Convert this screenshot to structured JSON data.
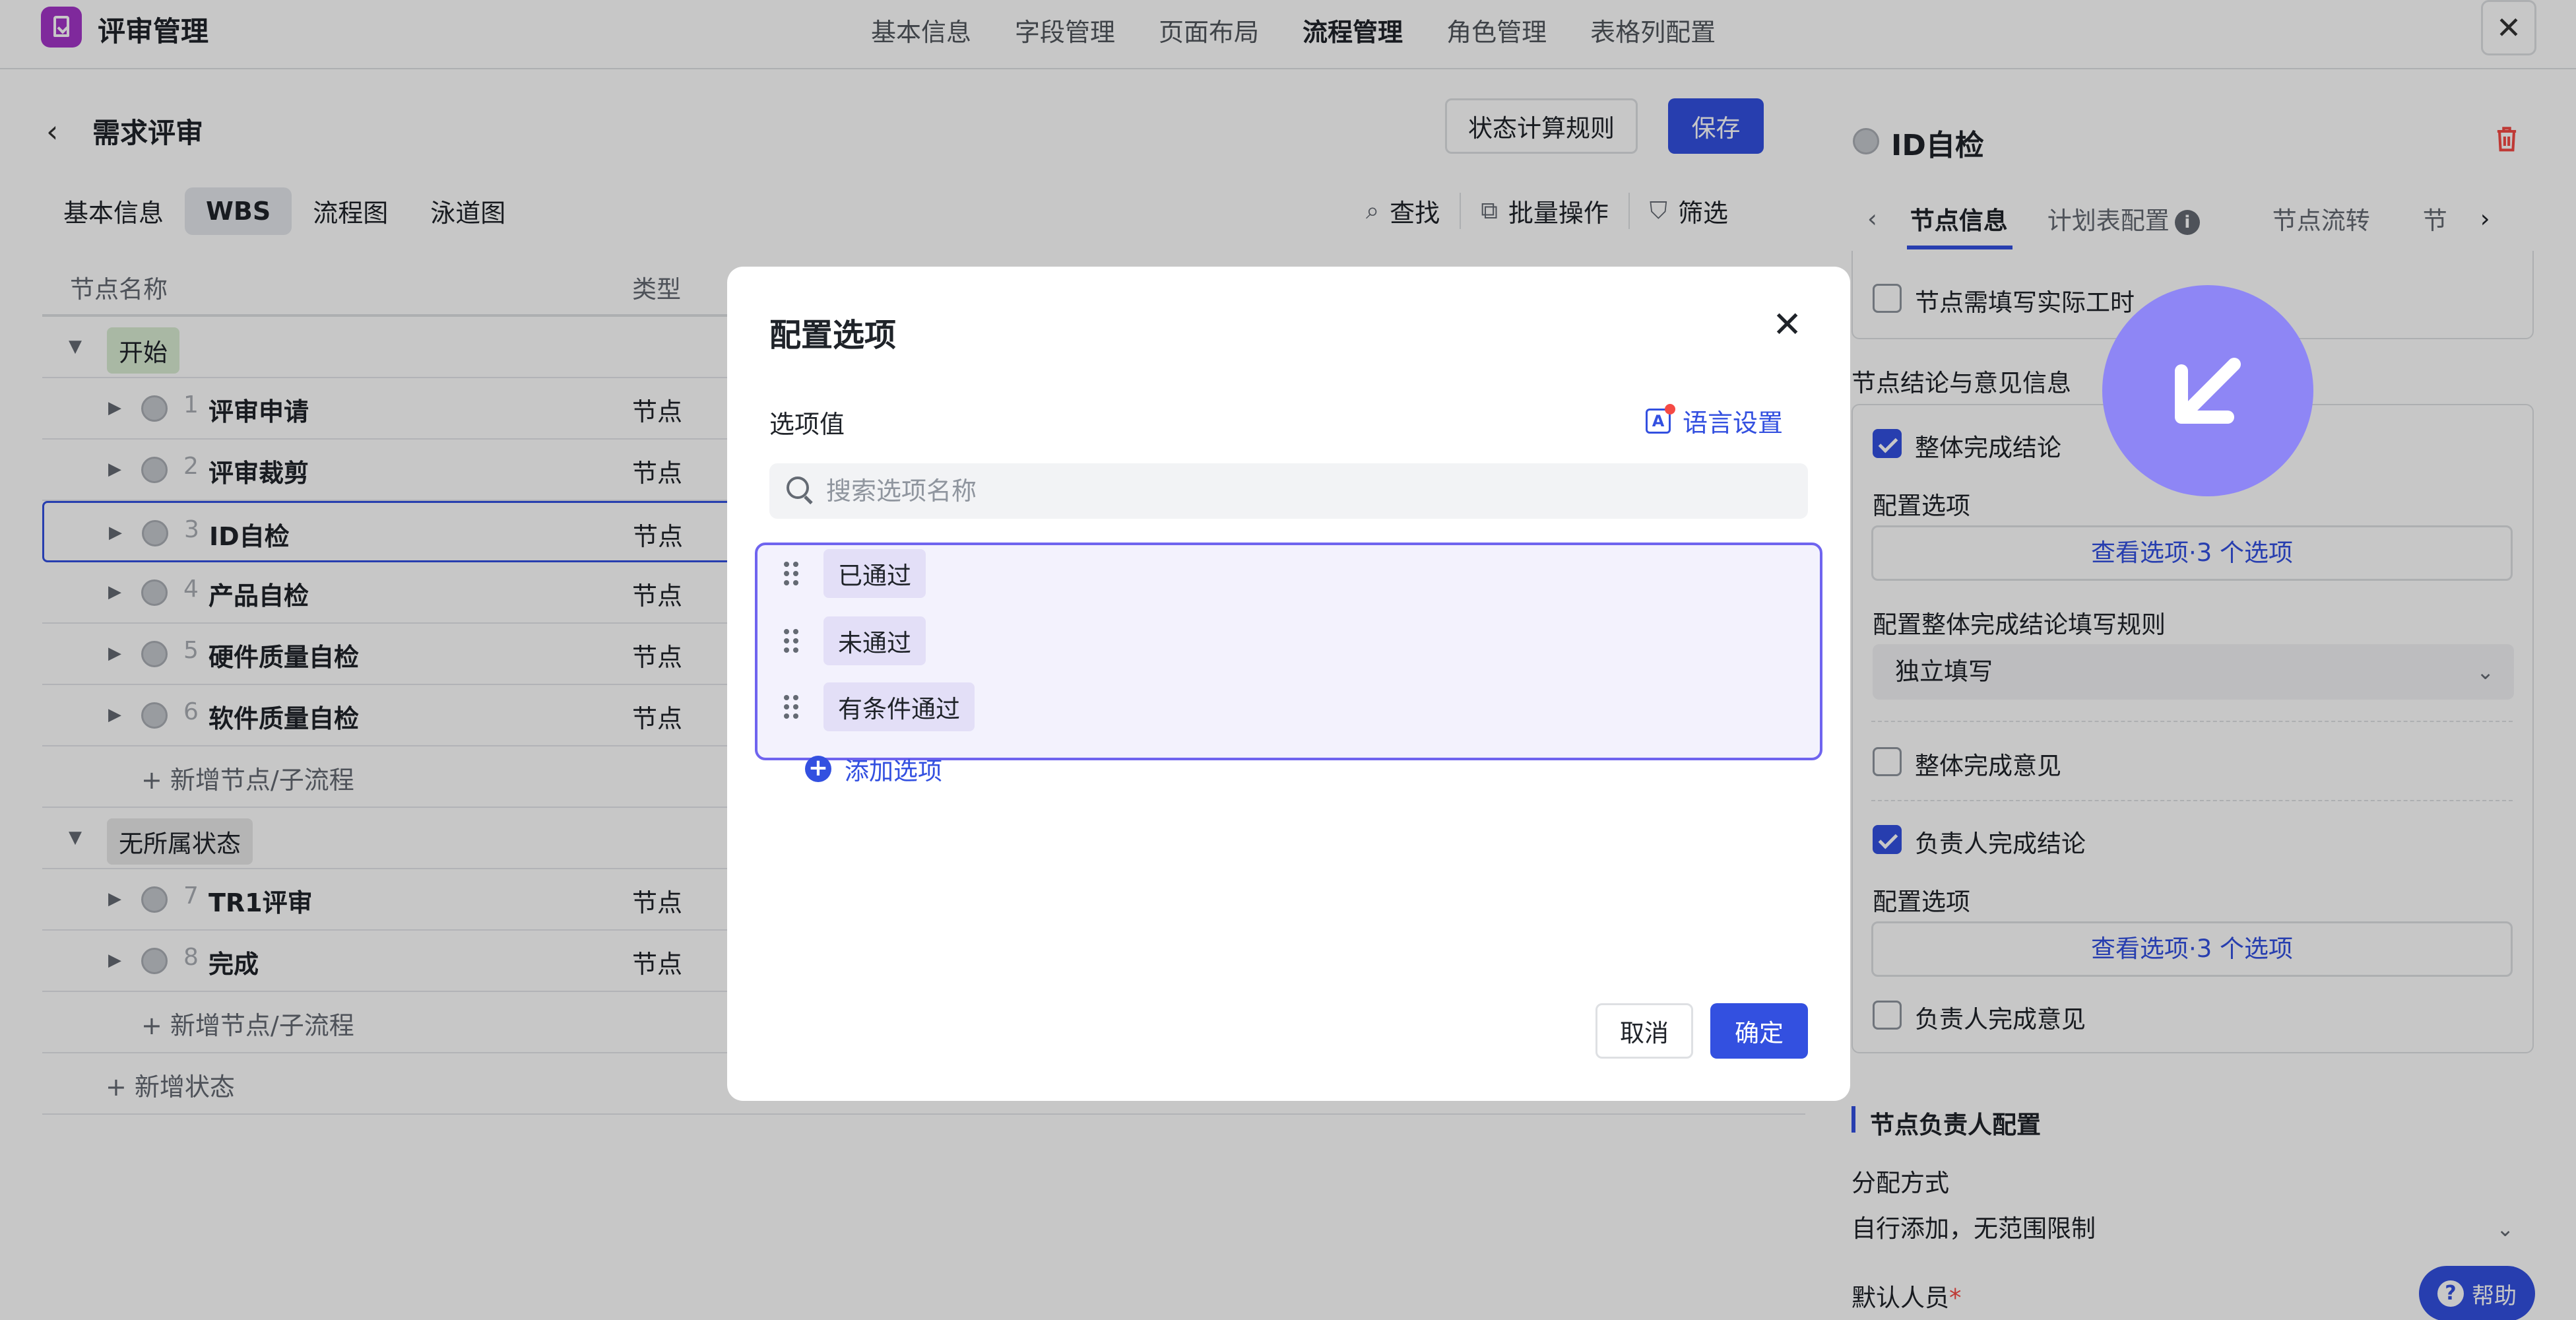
{
  "app": {
    "title": "评审管理"
  },
  "top_nav": [
    "基本信息",
    "字段管理",
    "页面布局",
    "流程管理",
    "角色管理",
    "表格列配置"
  ],
  "top_nav_active": "流程管理",
  "page": {
    "title": "需求评审",
    "rule_button": "状态计算规则",
    "save_button": "保存",
    "subtabs": [
      "基本信息",
      "WBS",
      "流程图",
      "泳道图"
    ],
    "subtab_active": "WBS",
    "tools": {
      "find": "查找",
      "batch": "批量操作",
      "filter": "筛选"
    }
  },
  "table": {
    "headers": {
      "name": "节点名称",
      "type": "类型"
    },
    "groups": [
      {
        "label": "开始",
        "color": "#dff0d8"
      },
      {
        "label": "无所属状态",
        "color": "#ededed"
      }
    ],
    "rows": [
      {
        "idx": "1",
        "name": "评审申请",
        "type": "节点"
      },
      {
        "idx": "2",
        "name": "评审裁剪",
        "type": "节点"
      },
      {
        "idx": "3",
        "name": "ID自检",
        "type": "节点"
      },
      {
        "idx": "4",
        "name": "产品自检",
        "type": "节点"
      },
      {
        "idx": "5",
        "name": "硬件质量自检",
        "type": "节点"
      },
      {
        "idx": "6",
        "name": "软件质量自检",
        "type": "节点"
      },
      {
        "idx": "7",
        "name": "TR1评审",
        "type": "节点"
      },
      {
        "idx": "8",
        "name": "完成",
        "type": "节点"
      }
    ],
    "add_node": "新增节点/子流程",
    "add_state": "新增状态"
  },
  "right_panel": {
    "title": "ID自检",
    "tabs": [
      "节点信息",
      "计划表配置",
      "节点流转",
      "节"
    ],
    "tab_active": "节点信息",
    "checkbox_actual_hours": "节点需填写实际工时",
    "section_conclusion": "节点结论与意见信息",
    "overall_conclusion": "整体完成结论",
    "config_options": "配置选项",
    "view_options_1": "查看选项·3 个选项",
    "rule_label": "配置整体完成结论填写规则",
    "rule_value": "独立填写",
    "overall_opinion": "整体完成意见",
    "owner_conclusion": "负责人完成结论",
    "config_options_2": "配置选项",
    "view_options_2": "查看选项·3 个选项",
    "owner_opinion": "负责人完成意见",
    "section_owner": "节点负责人配置",
    "assign_label": "分配方式",
    "assign_value": "自行添加，无范围限制",
    "default_person": "默认人员",
    "required_mark": "*",
    "help": "帮助"
  },
  "modal": {
    "title": "配置选项",
    "label": "选项值",
    "lang_settings": "语言设置",
    "search_placeholder": "搜索选项名称",
    "options": [
      "已通过",
      "未通过",
      "有条件通过"
    ],
    "add_option": "添加选项",
    "cancel": "取消",
    "ok": "确定"
  },
  "colors": {
    "accent": "#3350e0",
    "cursor": "#8e86f5",
    "app_icon": "#a335c8"
  }
}
